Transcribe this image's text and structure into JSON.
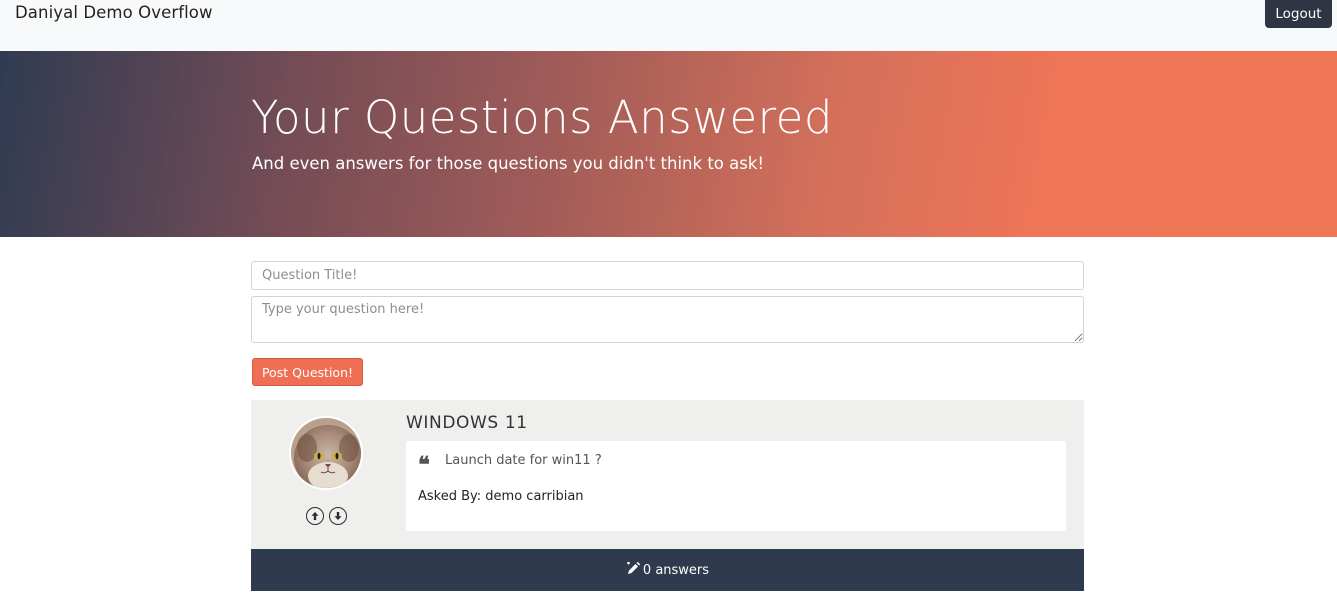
{
  "navbar": {
    "brand": "Daniyal Demo Overflow",
    "logout_label": "Logout"
  },
  "hero": {
    "title": "Your Questions Answered",
    "subtitle": "And even answers for those questions you didn't think to ask!"
  },
  "form": {
    "title_placeholder": "Question Title!",
    "question_placeholder": "Type your question here!",
    "post_label": "Post Question!"
  },
  "question": {
    "title": "WINDOWS 11",
    "body": "Launch date for win11 ?",
    "asked_by": "Asked By: demo carribian",
    "avatar_icon": "cat-avatar",
    "upvote_icon": "arrow-up-circle-icon",
    "downvote_icon": "arrow-down-circle-icon",
    "answers_label": "0 answers",
    "answers_icon": "pen-icon"
  },
  "colors": {
    "navbar_bg": "#f8f9fa",
    "accent": "#ef6f55",
    "dark": "#303a4f",
    "card_bg": "#efefed"
  }
}
